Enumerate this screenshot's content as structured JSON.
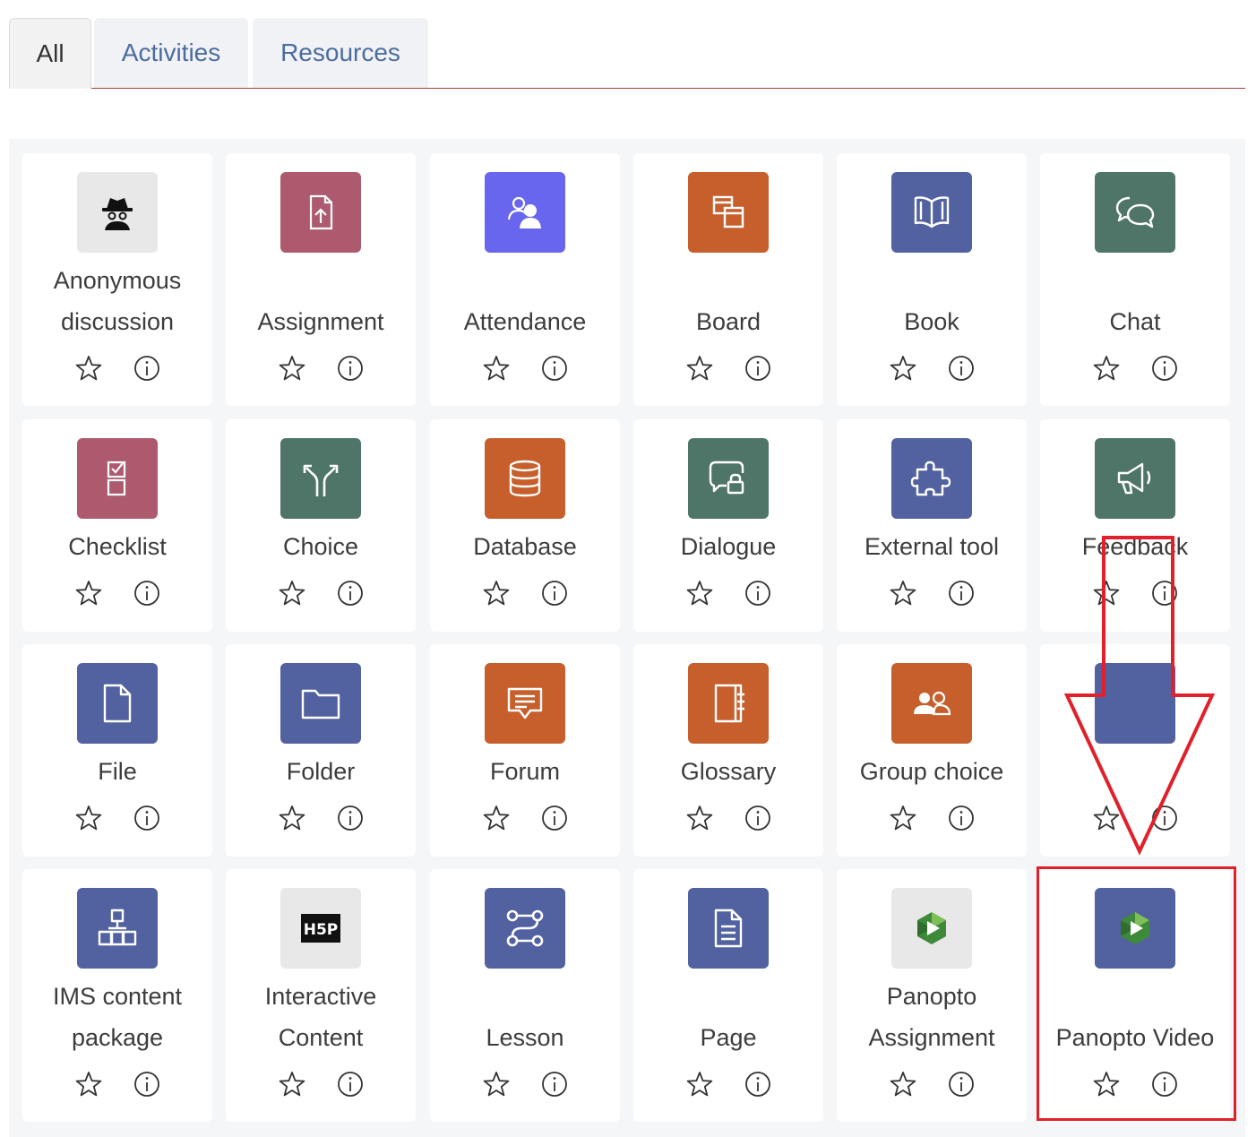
{
  "tabs": [
    {
      "label": "All",
      "active": true
    },
    {
      "label": "Activities",
      "active": false
    },
    {
      "label": "Resources",
      "active": false
    }
  ],
  "colors": {
    "resource_blue": "#5262a0",
    "activity_green": "#4f7568",
    "activity_orange": "#c65f2c",
    "activity_pink": "#ad5a6e",
    "attendance_purple": "#6866ee",
    "neutral_gray": "#e8e8e8",
    "highlight_red": "#e0202a",
    "tab_text": "#4b6c9e"
  },
  "modules": [
    {
      "name_line1": "Anonymous",
      "name_line2": "discussion",
      "icon": "anonymous-spy-icon"
    },
    {
      "name_line1": "",
      "name_line2": "Assignment",
      "icon": "assignment-upload-icon"
    },
    {
      "name_line1": "",
      "name_line2": "Attendance",
      "icon": "attendance-people-icon"
    },
    {
      "name_line1": "",
      "name_line2": "Board",
      "icon": "board-icon"
    },
    {
      "name_line1": "",
      "name_line2": "Book",
      "icon": "book-icon"
    },
    {
      "name_line1": "",
      "name_line2": "Chat",
      "icon": "chat-bubbles-icon"
    },
    {
      "name_line1": "Checklist",
      "name_line2": "",
      "icon": "checklist-icon"
    },
    {
      "name_line1": "Choice",
      "name_line2": "",
      "icon": "choice-fork-icon"
    },
    {
      "name_line1": "Database",
      "name_line2": "",
      "icon": "database-icon"
    },
    {
      "name_line1": "Dialogue",
      "name_line2": "",
      "icon": "dialogue-lock-icon"
    },
    {
      "name_line1": "External tool",
      "name_line2": "",
      "icon": "puzzle-icon"
    },
    {
      "name_line1": "Feedback",
      "name_line2": "",
      "icon": "megaphone-icon"
    },
    {
      "name_line1": "File",
      "name_line2": "",
      "icon": "file-icon"
    },
    {
      "name_line1": "Folder",
      "name_line2": "",
      "icon": "folder-icon"
    },
    {
      "name_line1": "Forum",
      "name_line2": "",
      "icon": "forum-icon"
    },
    {
      "name_line1": "Glossary",
      "name_line2": "",
      "icon": "glossary-icon"
    },
    {
      "name_line1": "Group choice",
      "name_line2": "",
      "icon": "group-choice-icon"
    },
    {
      "name_line1": "",
      "name_line2": "",
      "icon": "module-icon"
    },
    {
      "name_line1": "IMS content",
      "name_line2": "package",
      "icon": "ims-package-icon"
    },
    {
      "name_line1": "Interactive",
      "name_line2": "Content",
      "icon": "h5p-icon"
    },
    {
      "name_line1": "",
      "name_line2": "Lesson",
      "icon": "lesson-path-icon"
    },
    {
      "name_line1": "",
      "name_line2": "Page",
      "icon": "page-icon"
    },
    {
      "name_line1": "Panopto",
      "name_line2": "Assignment",
      "icon": "panopto-icon"
    },
    {
      "name_line1": "",
      "name_line2": "Panopto Video",
      "icon": "panopto-icon"
    }
  ]
}
